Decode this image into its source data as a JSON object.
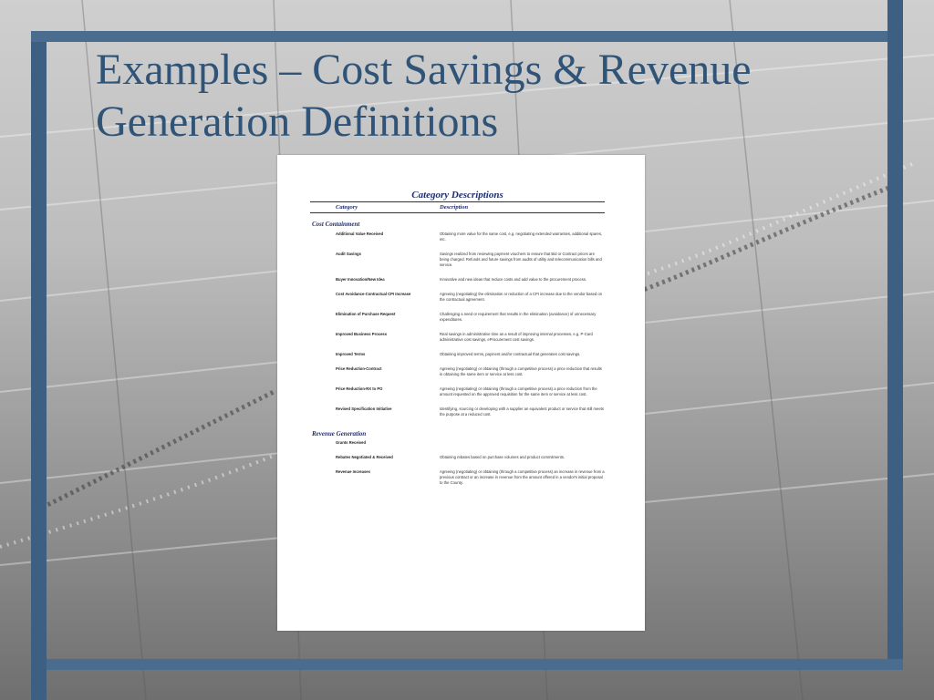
{
  "slide": {
    "title": "Examples – Cost Savings & Revenue Generation Definitions"
  },
  "document": {
    "title": "Category Descriptions",
    "column_headers": [
      "Category",
      "Description"
    ],
    "sections": [
      {
        "name": "Cost Containment",
        "rows": [
          {
            "category": "Additional Value Received",
            "description": "Obtaining more value for the same cost, e.g. negotiating extended warranties, additional spares, etc."
          },
          {
            "category": "Audit Savings",
            "description": "Savings realized from reviewing payment vouchers to ensure that Bid or Contract prices are being charged. Refunds and future savings from audits of utility and telecommunication bills and service."
          },
          {
            "category": "Buyer Innovation/New Idea",
            "description": "Innovative and new ideas that reduce costs and add value to the procurement process."
          },
          {
            "category": "Cost Avoidance-Contractual CPI Increase",
            "description": "Agreeing (negotiating) the elimination or reduction of a CPI increase due to the vendor based on the contractual agreement."
          },
          {
            "category": "Elimination of Purchase Request",
            "description": "Challenging a need or requirement that results in the elimination (avoidance) of unnecessary expenditures."
          },
          {
            "category": "Improved Business Process",
            "description": "Real savings in administrative time as a result of improving internal processes, e.g. P-Card administrative cost savings, eProcurement cost savings."
          },
          {
            "category": "Improved Terms",
            "description": "Obtaining improved terms, payment and/or contractual that generates cost savings."
          },
          {
            "category": "Price Reduction-Contract",
            "description": "Agreeing (negotiating) or obtaining (through a competitive process) a price reduction that results in obtaining the same item or service at less cost."
          },
          {
            "category": "Price Reduction-RX to PO",
            "description": "Agreeing (negotiating) or obtaining (through a competitive process) a price reduction from the amount requested on the approved requisition for the same item or service at less cost."
          },
          {
            "category": "Revised Specification Initiative",
            "description": "Identifying, sourcing or developing with a supplier an equivalent product or service that still meets the purpose at a reduced cost."
          }
        ]
      },
      {
        "name": "Revenue Generation",
        "rows": [
          {
            "category": "Grants Received",
            "description": ""
          },
          {
            "category": "Rebates Negotiated & Received",
            "description": "Obtaining rebates based on purchase volumes and product commitments."
          },
          {
            "category": "Revenue Increases",
            "description": "Agreeing (negotiating) or obtaining (through a competitive process) an increase in revenue from a previous contract or an increase in revenue from the amount offered in a vendor's initial proposal to the County."
          }
        ]
      }
    ]
  }
}
